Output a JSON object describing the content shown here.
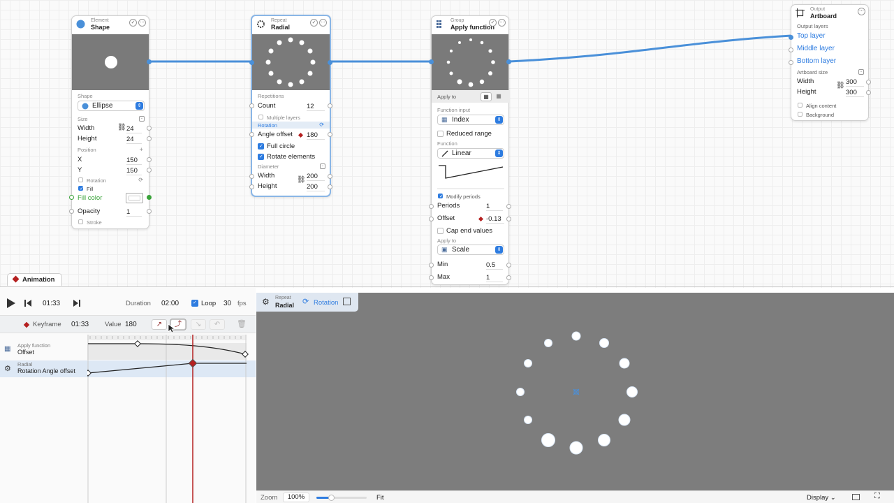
{
  "nodes": {
    "shape": {
      "kind": "Element",
      "title": "Shape",
      "shape_section": "Shape",
      "shape_value": "Ellipse",
      "size_section": "Size",
      "width_label": "Width",
      "width_value": "24",
      "height_label": "Height",
      "height_value": "24",
      "position_section": "Position",
      "x_label": "X",
      "x_value": "150",
      "y_label": "Y",
      "y_value": "150",
      "rotation_label": "Rotation",
      "fill_label": "Fill",
      "fill_color_label": "Fill color",
      "opacity_label": "Opacity",
      "opacity_value": "1",
      "stroke_label": "Stroke"
    },
    "radial": {
      "kind": "Repeat",
      "title": "Radial",
      "repetitions_section": "Repetitions",
      "count_label": "Count",
      "count_value": "12",
      "multiple_layers_label": "Multiple layers",
      "rotation_section": "Rotation",
      "angle_offset_label": "Angle offset",
      "angle_offset_value": "180",
      "full_circle_label": "Full circle",
      "rotate_elements_label": "Rotate elements",
      "diameter_section": "Diameter",
      "width_label": "Width",
      "width_value": "200",
      "height_label": "Height",
      "height_value": "200"
    },
    "apply": {
      "kind": "Group",
      "title": "Apply function",
      "apply_to_label": "Apply to",
      "function_input_section": "Function input",
      "function_input_value": "Index",
      "reduced_range_label": "Reduced range",
      "function_section": "Function",
      "function_value": "Linear",
      "modify_periods_label": "Modify periods",
      "periods_label": "Periods",
      "periods_value": "1",
      "offset_label": "Offset",
      "offset_value": "-0.13",
      "cap_end_values_label": "Cap end values",
      "apply_to_section": "Apply to",
      "apply_to_value": "Scale",
      "min_label": "Min",
      "min_value": "0.5",
      "max_label": "Max",
      "max_value": "1"
    },
    "artboard": {
      "kind": "Output",
      "title": "Artboard",
      "output_layers_section": "Output layers",
      "layers": [
        "Top layer",
        "Middle layer",
        "Bottom layer"
      ],
      "artboard_size_section": "Artboard size",
      "width_label": "Width",
      "width_value": "300",
      "height_label": "Height",
      "height_value": "300",
      "align_content_label": "Align content",
      "background_label": "Background"
    }
  },
  "animation": {
    "tab_label": "Animation",
    "current_time": "01:33",
    "duration_label": "Duration",
    "duration_value": "02:00",
    "loop_label": "Loop",
    "fps_value": "30",
    "fps_label": "fps",
    "keyframe_label": "Keyframe",
    "keyframe_time": "01:33",
    "value_label": "Value",
    "value_value": "180",
    "tracks": [
      {
        "kind": "Apply function",
        "name": "Offset"
      },
      {
        "kind": "Radial",
        "name": "Rotation Angle offset"
      }
    ]
  },
  "viewport": {
    "chip_kind": "Repeat",
    "chip_title": "Radial",
    "chip_mode": "Rotation"
  },
  "statusbar": {
    "zoom_label": "Zoom",
    "zoom_value": "100%",
    "fit_label": "Fit",
    "display_label": "Display"
  },
  "colors": {
    "link": "#4a90d9",
    "accent": "#2e7ce0",
    "keyframe": "#b52020",
    "preview_bg": "#7a7a7a"
  }
}
